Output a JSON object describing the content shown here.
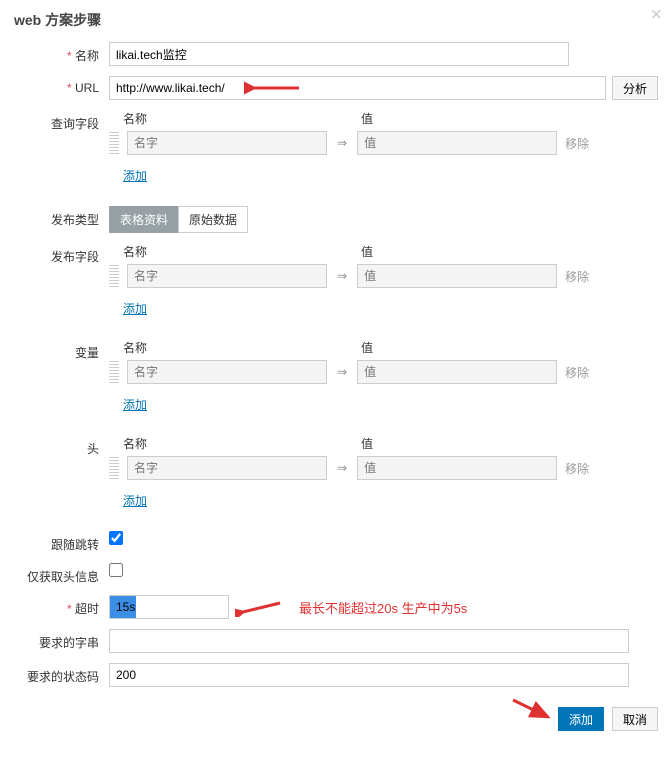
{
  "title": "web 方案步骤",
  "labels": {
    "name": "名称",
    "url": "URL",
    "query_fields": "查询字段",
    "publish_type": "发布类型",
    "publish_fields": "发布字段",
    "variables": "变量",
    "headers": "头",
    "follow_redirect": "跟随跳转",
    "head_only": "仅获取头信息",
    "timeout": "超时",
    "required_str": "要求的字串",
    "required_status": "要求的状态码"
  },
  "values": {
    "name": "likai.tech监控",
    "url": "http://www.likai.tech/",
    "timeout": "15s",
    "required_str": "",
    "required_status": "200"
  },
  "buttons": {
    "analyze": "分析",
    "add": "添加",
    "cancel": "取消"
  },
  "tabs": {
    "form_data": "表格资料",
    "raw_data": "原始数据"
  },
  "kv": {
    "name_header": "名称",
    "value_header": "值",
    "name_placeholder": "名字",
    "value_placeholder": "值",
    "remove": "移除",
    "add": "添加"
  },
  "annotations": {
    "timeout_note": "最长不能超过20s 生产中为5s"
  },
  "arrow_symbol": "⇒"
}
